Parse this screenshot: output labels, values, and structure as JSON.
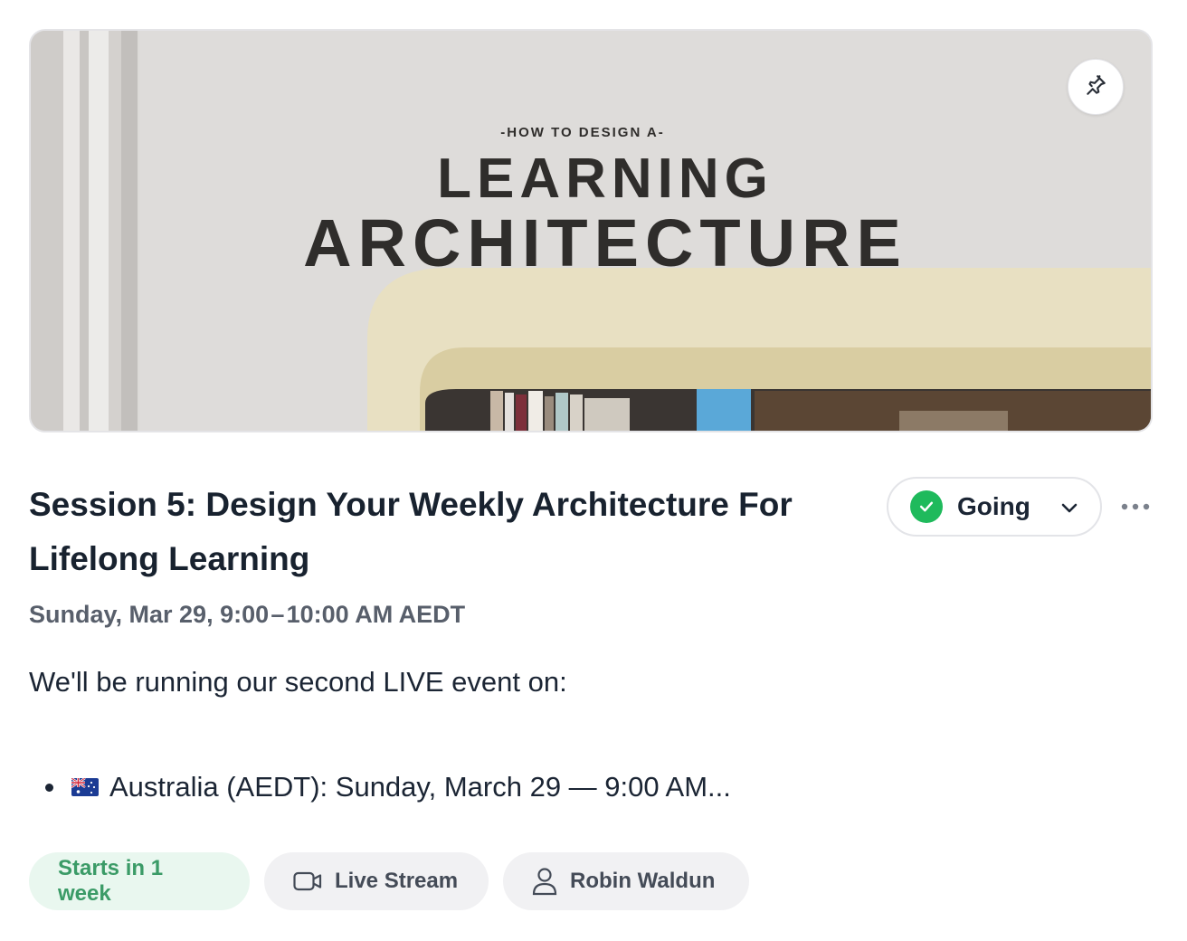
{
  "event": {
    "cover": {
      "kicker": "-HOW TO DESIGN A-",
      "line1": "LEARNING",
      "line2": "ARCHITECTURE"
    },
    "title": "Session 5: Design Your Weekly Architecture For Lifelong Learning",
    "datetime": "Sunday, Mar 29, 9:00 – 10:00 AM AEDT",
    "description": "We'll be running our second LIVE event on:",
    "bullets": [
      {
        "flag": "australia-flag-icon",
        "text": "Australia (AEDT): Sunday, March 29 — 9:00 AM..."
      }
    ]
  },
  "rsvp": {
    "label": "Going",
    "status_color": "#1fba5c"
  },
  "chips": {
    "starts": "Starts in 1 week",
    "stream": "Live Stream",
    "host": "Robin Waldun"
  },
  "icons": {
    "pin": "pin-icon",
    "check": "check-icon",
    "chevron": "chevron-down-icon",
    "more": "more-horizontal-icon",
    "video": "video-camera-icon",
    "user": "user-icon"
  }
}
